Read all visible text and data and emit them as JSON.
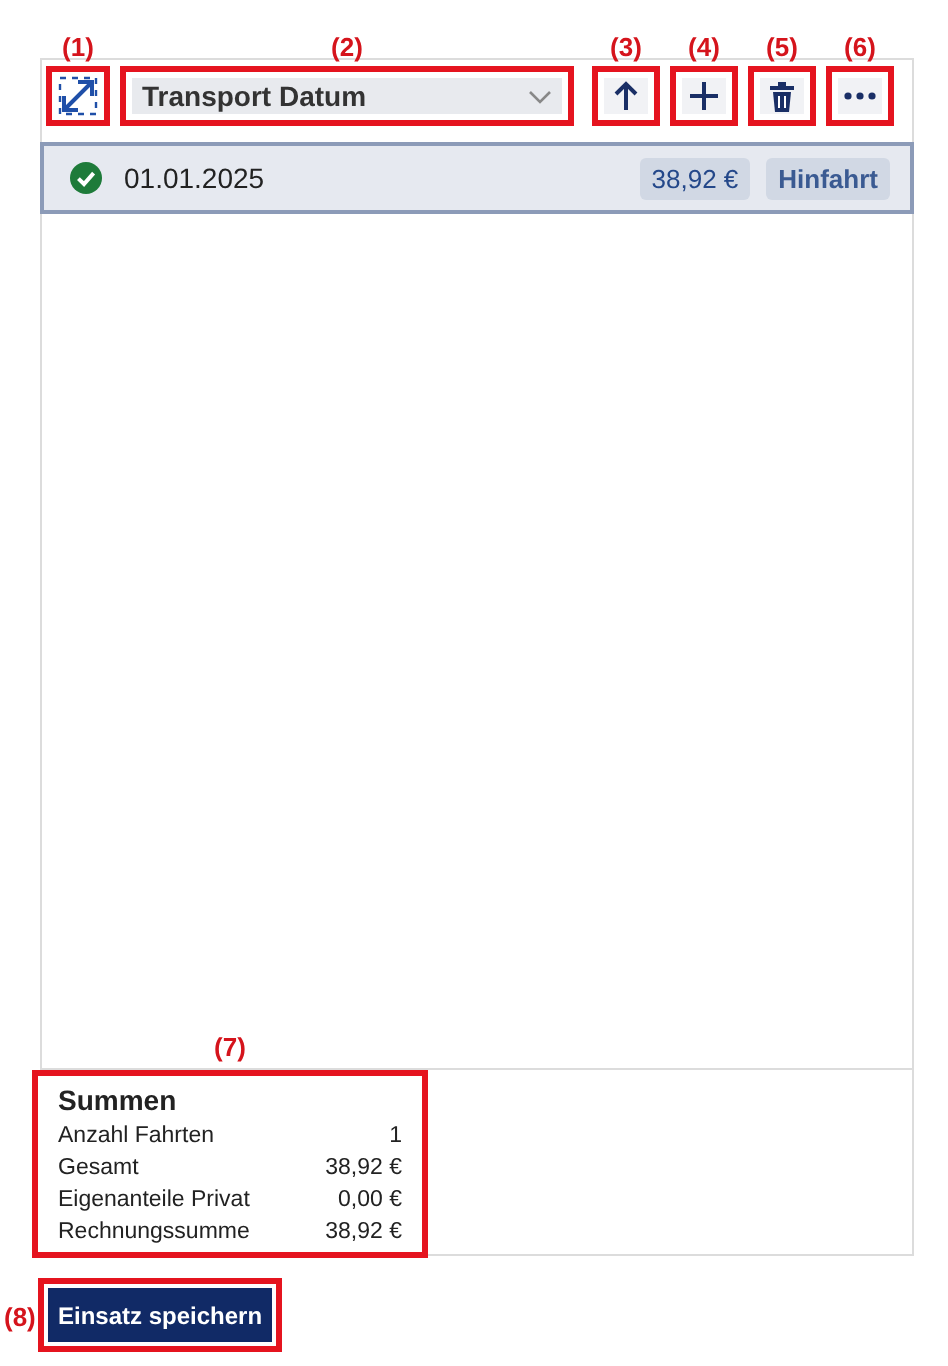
{
  "toolbar": {
    "expand_button": {
      "callout": "(1)"
    },
    "sort_field": {
      "value": "Transport Datum",
      "callout": "(2)"
    },
    "buttons": [
      {
        "kind": "up",
        "callout": "(3)"
      },
      {
        "kind": "add",
        "callout": "(4)"
      },
      {
        "kind": "delete",
        "callout": "(5)"
      },
      {
        "kind": "more",
        "callout": "(6)"
      }
    ]
  },
  "entries": [
    {
      "completed": true,
      "date": "01.01.2025",
      "amount": "38,92 €",
      "tag": "Hinfahrt"
    }
  ],
  "summary": {
    "callout": "(7)",
    "title": "Summen",
    "rows": [
      {
        "label": "Anzahl Fahrten",
        "value": "1"
      },
      {
        "label": "Gesamt",
        "value": "38,92 €"
      },
      {
        "label": "Eigenanteile Privat",
        "value": "0,00 €"
      },
      {
        "label": "Rechnungssumme",
        "value": "38,92 €"
      }
    ]
  },
  "save_button": {
    "label": "Einsatz speichern",
    "callout": "(8)"
  }
}
